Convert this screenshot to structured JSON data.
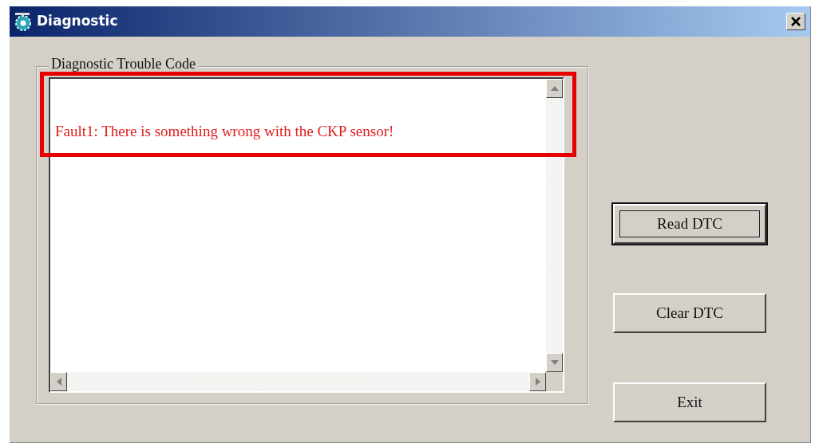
{
  "window": {
    "title": "Diagnostic"
  },
  "group": {
    "label": "Diagnostic Trouble Code"
  },
  "messages": [
    {
      "text": "Fault1: There is something wrong with the CKP sensor!",
      "highlighted": true
    }
  ],
  "buttons": [
    {
      "label": "Read DTC",
      "focused": true
    },
    {
      "label": "Clear DTC",
      "focused": false
    },
    {
      "label": "Exit",
      "focused": false
    }
  ]
}
